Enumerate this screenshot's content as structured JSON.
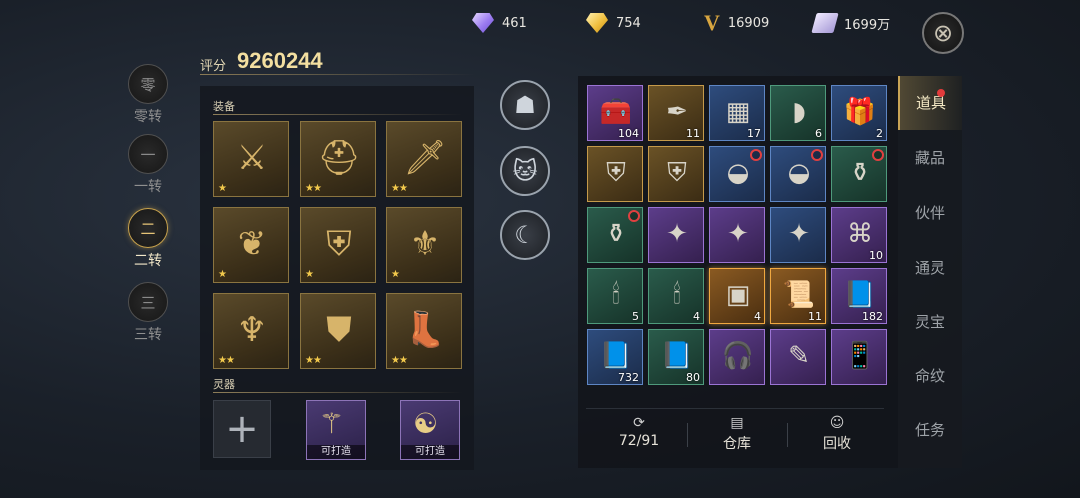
{
  "currencies": [
    {
      "icon": "purple-diamond-icon",
      "value": "461"
    },
    {
      "icon": "gold-diamond-icon",
      "value": "754"
    },
    {
      "icon": "v-points-icon",
      "value": "16909"
    },
    {
      "icon": "ticket-icon",
      "value": "1699万"
    }
  ],
  "ranks": [
    {
      "glyph": "零",
      "label": "零转",
      "active": false
    },
    {
      "glyph": "一",
      "label": "一转",
      "active": false
    },
    {
      "glyph": "二",
      "label": "二转",
      "active": true
    },
    {
      "glyph": "三",
      "label": "三转",
      "active": false
    }
  ],
  "score": {
    "label": "评分",
    "value": "9260244"
  },
  "equipment": {
    "title": "装备",
    "slots": [
      {
        "icon": "sword-icon",
        "stars": "★"
      },
      {
        "icon": "helmet-icon",
        "stars": "★★"
      },
      {
        "icon": "blade-icon",
        "stars": "★★"
      },
      {
        "icon": "amulet-icon",
        "stars": "★"
      },
      {
        "icon": "armor-icon",
        "stars": "★"
      },
      {
        "icon": "bracer-icon",
        "stars": "★"
      },
      {
        "icon": "belt-icon",
        "stars": "★★"
      },
      {
        "icon": "chestplate-icon",
        "stars": "★★"
      },
      {
        "icon": "boots-icon",
        "stars": "★★"
      }
    ]
  },
  "spirit": {
    "title": "灵器",
    "forge_label": "可打造"
  },
  "companions": [
    {
      "icon": "helmet-mask-icon"
    },
    {
      "icon": "cat-icon"
    },
    {
      "icon": "beast-icon"
    }
  ],
  "bag": {
    "items": [
      {
        "icon": "chest-icon",
        "quality": "purple",
        "count": "104",
        "locked": false
      },
      {
        "icon": "brush-icon",
        "quality": "gold",
        "count": "11",
        "locked": false
      },
      {
        "icon": "crate-icon",
        "quality": "blue",
        "count": "17",
        "locked": false
      },
      {
        "icon": "jade-icon",
        "quality": "green",
        "count": "6",
        "locked": false
      },
      {
        "icon": "gift-icon",
        "quality": "blue",
        "count": "2",
        "locked": false
      },
      {
        "icon": "armor-icon",
        "quality": "gold",
        "count": "",
        "locked": false
      },
      {
        "icon": "armor-icon",
        "quality": "gold",
        "count": "",
        "locked": false
      },
      {
        "icon": "bowl-icon",
        "quality": "blue",
        "count": "",
        "locked": true
      },
      {
        "icon": "bowl-icon",
        "quality": "blue",
        "count": "",
        "locked": true
      },
      {
        "icon": "gourd-icon",
        "quality": "green",
        "count": "",
        "locked": true
      },
      {
        "icon": "gourd-icon",
        "quality": "green",
        "count": "",
        "locked": true
      },
      {
        "icon": "card-icon",
        "quality": "purple",
        "count": "",
        "locked": false
      },
      {
        "icon": "card-icon",
        "quality": "purple",
        "count": "",
        "locked": false
      },
      {
        "icon": "card-icon",
        "quality": "blue",
        "count": "",
        "locked": false
      },
      {
        "icon": "relic-icon",
        "quality": "purple",
        "count": "10",
        "locked": false
      },
      {
        "icon": "candle-icon",
        "quality": "green",
        "count": "5",
        "locked": false
      },
      {
        "icon": "candle-icon",
        "quality": "green",
        "count": "4",
        "locked": false
      },
      {
        "icon": "sim-card-icon",
        "quality": "orange",
        "count": "4",
        "locked": false
      },
      {
        "icon": "scroll-icon",
        "quality": "orange",
        "count": "11",
        "locked": false
      },
      {
        "icon": "book-icon",
        "quality": "purple",
        "count": "182",
        "locked": false
      },
      {
        "icon": "book-icon",
        "quality": "blue",
        "count": "732",
        "locked": false
      },
      {
        "icon": "book-icon",
        "quality": "green",
        "count": "80",
        "locked": false
      },
      {
        "icon": "headphones-icon",
        "quality": "purple",
        "count": "",
        "locked": false
      },
      {
        "icon": "needle-icon",
        "quality": "purple",
        "count": "",
        "locked": false
      },
      {
        "icon": "phone-icon",
        "quality": "purple",
        "count": "",
        "locked": false
      }
    ],
    "actions": [
      {
        "icon": "refresh-icon",
        "label": "72/91"
      },
      {
        "icon": "warehouse-icon",
        "label": "仓库"
      },
      {
        "icon": "recycle-icon",
        "label": "回收"
      }
    ]
  },
  "tabs": [
    {
      "label": "道具",
      "active": true
    },
    {
      "label": "藏品",
      "active": false
    },
    {
      "label": "伙伴",
      "active": false
    },
    {
      "label": "通灵",
      "active": false
    },
    {
      "label": "灵宝",
      "active": false
    },
    {
      "label": "命纹",
      "active": false
    },
    {
      "label": "任务",
      "active": false
    }
  ]
}
